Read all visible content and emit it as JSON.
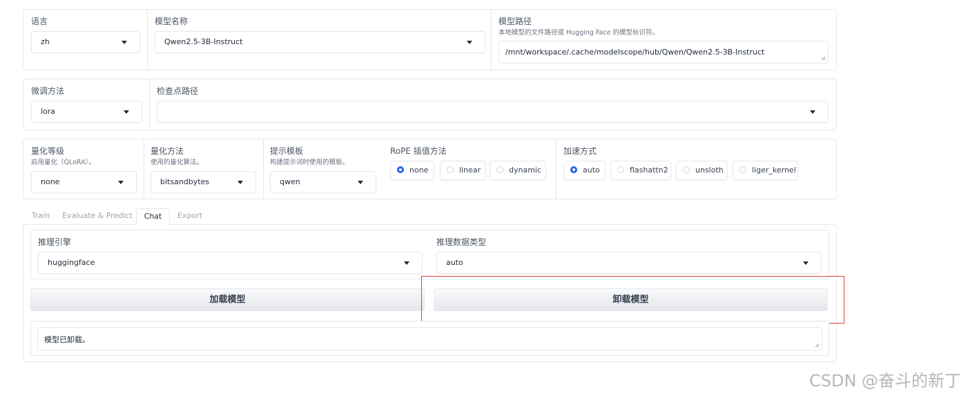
{
  "top": {
    "lang": {
      "label": "语言",
      "value": "zh"
    },
    "model_name": {
      "label": "模型名称",
      "value": "Qwen2.5-3B-Instruct"
    },
    "model_path": {
      "label": "模型路径",
      "info": "本地模型的文件路径或 Hugging Face 的模型标识符。",
      "value": "/mnt/workspace/.cache/modelscope/hub/Qwen/Qwen2.5-3B-Instruct"
    }
  },
  "finetune": {
    "method": {
      "label": "微调方法",
      "value": "lora"
    },
    "checkpoint": {
      "label": "检查点路径",
      "value": ""
    }
  },
  "advanced": {
    "quant_bit": {
      "label": "量化等级",
      "info": "启用量化（QLoRA）。",
      "value": "none"
    },
    "quant_method": {
      "label": "量化方法",
      "info": "使用的量化算法。",
      "value": "bitsandbytes"
    },
    "template": {
      "label": "提示模板",
      "info": "构建提示词时使用的模板。",
      "value": "qwen"
    },
    "rope": {
      "label": "RoPE 插值方法",
      "options": [
        "none",
        "linear",
        "dynamic"
      ],
      "selected": "none"
    },
    "booster": {
      "label": "加速方式",
      "options": [
        "auto",
        "flashattn2",
        "unsloth",
        "liger_kernel"
      ],
      "selected": "auto"
    }
  },
  "tabs": [
    "Train",
    "Evaluate & Predict",
    "Chat",
    "Export"
  ],
  "active_tab": "Chat",
  "chat": {
    "infer_backend": {
      "label": "推理引擎",
      "value": "huggingface"
    },
    "infer_dtype": {
      "label": "推理数据类型",
      "value": "auto"
    },
    "load_button": "加载模型",
    "unload_button": "卸载模型",
    "info_box": "模型已卸载。"
  },
  "watermark": "CSDN @奋斗的新丁",
  "colors": {
    "accent": "#2563eb",
    "highlight": "#d94141"
  }
}
